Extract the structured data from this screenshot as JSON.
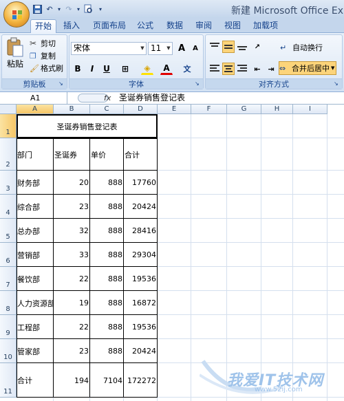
{
  "window": {
    "title": "新建 Microsoft Office Ex"
  },
  "qat": {
    "undo": "↶",
    "redo": "↷",
    "sep": "▾"
  },
  "tabs": [
    "开始",
    "插入",
    "页面布局",
    "公式",
    "数据",
    "审阅",
    "视图",
    "加载项"
  ],
  "ribbon": {
    "clipboard": {
      "label": "剪贴板",
      "paste": "粘贴",
      "cut": "剪切",
      "copy": "复制",
      "format_painter": "格式刷"
    },
    "font": {
      "label": "字体",
      "name": "宋体",
      "size": "11",
      "grow": "A",
      "shrink": "A",
      "bold": "B",
      "italic": "I",
      "underline": "U",
      "border": "⊞",
      "fill": "◈",
      "color": "A",
      "phonetic": "文"
    },
    "alignment": {
      "label": "对齐方式",
      "wrap": "自动换行",
      "merge": "合并后居中"
    }
  },
  "formula_bar": {
    "name_box": "A1",
    "fx": "fx",
    "content": "圣诞券销售登记表"
  },
  "columns": [
    "A",
    "B",
    "C",
    "D",
    "E",
    "F",
    "G",
    "H",
    "I"
  ],
  "rows": [
    "1",
    "2",
    "3",
    "4",
    "5",
    "6",
    "7",
    "8",
    "9",
    "10",
    "11"
  ],
  "table": {
    "title": "圣诞券销售登记表",
    "headers": [
      "部门",
      "圣诞券",
      "单价",
      "合计"
    ],
    "rows": [
      [
        "财务部",
        "20",
        "888",
        "17760"
      ],
      [
        "综合部",
        "23",
        "888",
        "20424"
      ],
      [
        "总办部",
        "32",
        "888",
        "28416"
      ],
      [
        "营销部",
        "33",
        "888",
        "29304"
      ],
      [
        "餐饮部",
        "22",
        "888",
        "19536"
      ],
      [
        "人力资源部",
        "19",
        "888",
        "16872"
      ],
      [
        "工程部",
        "22",
        "888",
        "19536"
      ],
      [
        "管家部",
        "23",
        "888",
        "20424"
      ],
      [
        "合计",
        "194",
        "7104",
        "172272"
      ]
    ]
  },
  "watermark": {
    "main": "我爱IT技术网",
    "url": "www.52ij.com"
  },
  "colors": {
    "accent": "#15428b",
    "selected_header": "#f6c667",
    "ribbon": "#d2e1f3"
  }
}
